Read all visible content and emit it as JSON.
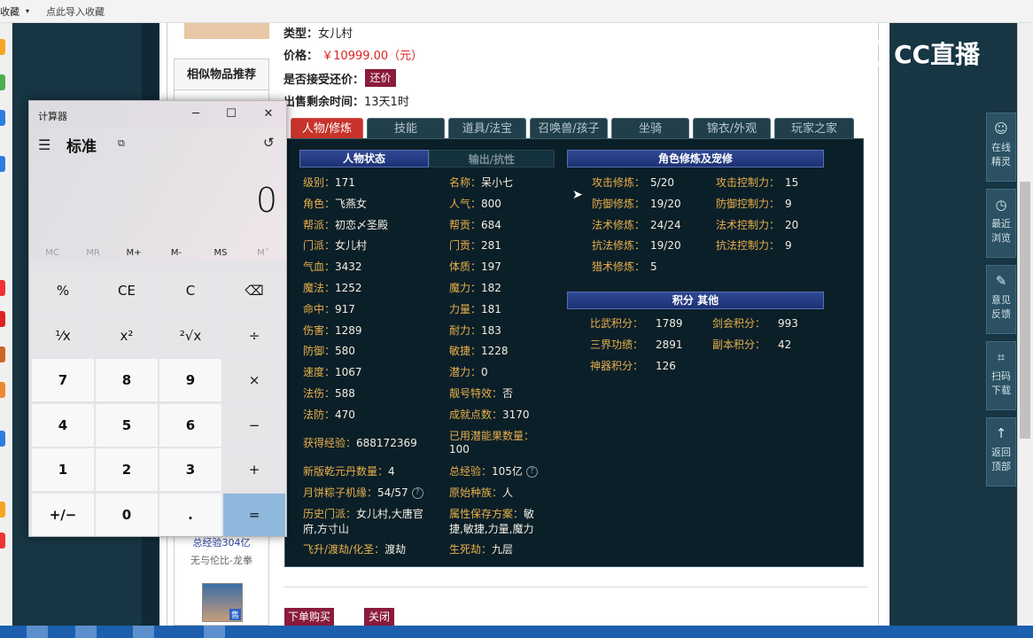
{
  "bookmarks": {
    "favorites": "收藏",
    "import": "点此导入收藏"
  },
  "item": {
    "type_label": "类型：",
    "type_value": "女儿村",
    "price_label": "价格：",
    "price_value": "￥10999.00（元）",
    "bargain_label": "是否接受还价：",
    "bargain_button": "还价",
    "remain_label": "出售剩余时间：",
    "remain_value": "13天1时"
  },
  "recommend": {
    "title": "相似物品推荐",
    "exp": "总经验304亿",
    "sub": "无与伦比-龙拳",
    "badge": "售"
  },
  "tabs": [
    "人物/修炼",
    "技能",
    "道具/法宝",
    "召唤兽/孩子",
    "坐骑",
    "锦衣/外观",
    "玩家之家"
  ],
  "sections": {
    "status": "人物状态",
    "output": "输出/抗性",
    "cultivation": "角色修炼及宠修",
    "points": "积分 其他"
  },
  "stats_left": [
    {
      "k": "级别：",
      "v": "171"
    },
    {
      "k": "角色：",
      "v": "飞燕女"
    },
    {
      "k": "帮派：",
      "v": "初恋〆圣殿"
    },
    {
      "k": "门派：",
      "v": "女儿村"
    },
    {
      "k": "气血：",
      "v": "3432"
    },
    {
      "k": "魔法：",
      "v": "1252"
    },
    {
      "k": "命中：",
      "v": "917"
    },
    {
      "k": "伤害：",
      "v": "1289"
    },
    {
      "k": "防御：",
      "v": "580"
    },
    {
      "k": "速度：",
      "v": "1067"
    },
    {
      "k": "法伤：",
      "v": "588"
    },
    {
      "k": "法防：",
      "v": "470"
    }
  ],
  "stats_right": [
    {
      "k": "名称：",
      "v": "呆小七"
    },
    {
      "k": "人气：",
      "v": "800"
    },
    {
      "k": "帮贡：",
      "v": "684"
    },
    {
      "k": "门贡：",
      "v": "281"
    },
    {
      "k": "体质：",
      "v": "197"
    },
    {
      "k": "魔力：",
      "v": "182"
    },
    {
      "k": "力量：",
      "v": "181"
    },
    {
      "k": "耐力：",
      "v": "183"
    },
    {
      "k": "敏捷：",
      "v": "1228"
    },
    {
      "k": "潜力：",
      "v": "0"
    },
    {
      "k": "靓号特效：",
      "v": "否"
    },
    {
      "k": "成就点数：",
      "v": "3170"
    }
  ],
  "extra": {
    "exp_k": "获得经验：",
    "exp_v": "688172369",
    "potion_k": "已用潜能果数量：",
    "potion_v": "100",
    "dan_k": "新版乾元丹数量：",
    "dan_v": "4",
    "total_k": "总经验：",
    "total_v": "105亿",
    "zongzi_k": "月饼粽子机缘：",
    "zongzi_v": "54/57",
    "race_k": "原始种族：",
    "race_v": "人",
    "history_k": "历史门派：",
    "history_v1": "女儿村,大唐官",
    "history_v2": "府,方寸山",
    "attr_k": "属性保存方案：",
    "attr_v1": "敏",
    "attr_v2": "捷,敏捷,力量,魔力",
    "fly_k": "飞升/渡劫/化圣：",
    "fly_v": "渡劫",
    "life_k": "生死劫：",
    "life_v": "九层",
    "help": "?"
  },
  "cultivation": [
    {
      "k": "攻击修炼：",
      "v": "5/20",
      "k2": "攻击控制力：",
      "v2": "15"
    },
    {
      "k": "防御修炼：",
      "v": "19/20",
      "k2": "防御控制力：",
      "v2": "9"
    },
    {
      "k": "法术修炼：",
      "v": "24/24",
      "k2": "法术控制力：",
      "v2": "20"
    },
    {
      "k": "抗法修炼：",
      "v": "19/20",
      "k2": "抗法控制力：",
      "v2": "9"
    },
    {
      "k": "猎术修炼：",
      "v": "5",
      "k2": "",
      "v2": ""
    }
  ],
  "points": [
    {
      "k": "比武积分：",
      "v": "1789",
      "k2": "剑会积分：",
      "v2": "993"
    },
    {
      "k": "三界功绩：",
      "v": "2891",
      "k2": "副本积分：",
      "v2": "42"
    },
    {
      "k": "神器积分：",
      "v": "126",
      "k2": "",
      "v2": ""
    }
  ],
  "buttons": {
    "buy": "下单购买",
    "close": "关闭"
  },
  "logo": "CC直播",
  "sidebar": [
    {
      "label1": "在线",
      "label2": "精灵",
      "icon": "☺"
    },
    {
      "label1": "最近",
      "label2": "浏览",
      "icon": "◷"
    },
    {
      "label1": "意见",
      "label2": "反馈",
      "icon": "✎"
    },
    {
      "label1": "扫码",
      "label2": "下载",
      "icon": "⌗"
    },
    {
      "label1": "返回",
      "label2": "顶部",
      "icon": "↑"
    }
  ],
  "calculator": {
    "title": "计算器",
    "mode": "标准",
    "display": "0",
    "memory": [
      "MC",
      "MR",
      "M+",
      "M-",
      "MS",
      "M˅"
    ],
    "keys": [
      [
        "%",
        "CE",
        "C",
        "⌫"
      ],
      [
        "¹⁄x",
        "x²",
        "²√x",
        "÷"
      ],
      [
        "7",
        "8",
        "9",
        "×"
      ],
      [
        "4",
        "5",
        "6",
        "−"
      ],
      [
        "1",
        "2",
        "3",
        "+"
      ],
      [
        "+/−",
        "0",
        ".",
        "="
      ]
    ]
  }
}
